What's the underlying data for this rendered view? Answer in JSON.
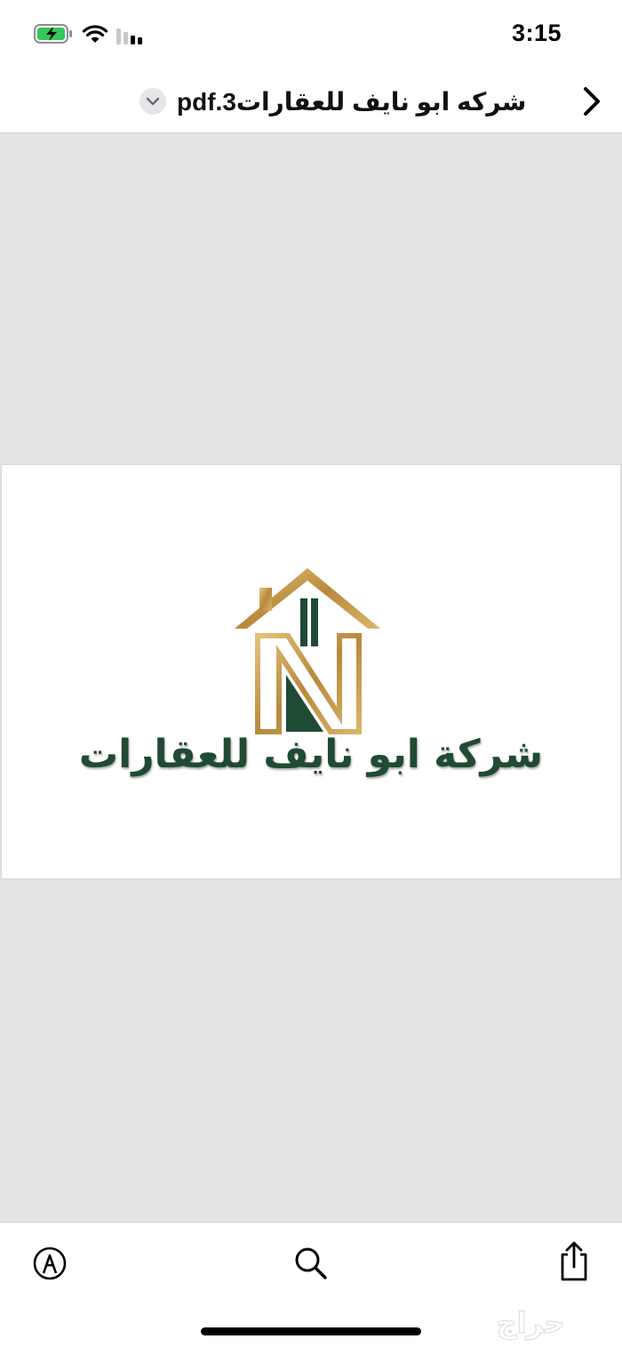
{
  "status_bar": {
    "time": "3:15"
  },
  "nav": {
    "title": "pdf.شركه ابو نايف للعقارات3"
  },
  "document": {
    "logo_text": "شركة ابو نايف للعقارات",
    "colors": {
      "gold": "#c39a4c",
      "green": "#1f4a34"
    }
  },
  "toolbar": {
    "markup_icon": "markup-pen-icon",
    "search_icon": "search-icon",
    "share_icon": "share-icon"
  },
  "watermark": {
    "text": "حراج"
  }
}
